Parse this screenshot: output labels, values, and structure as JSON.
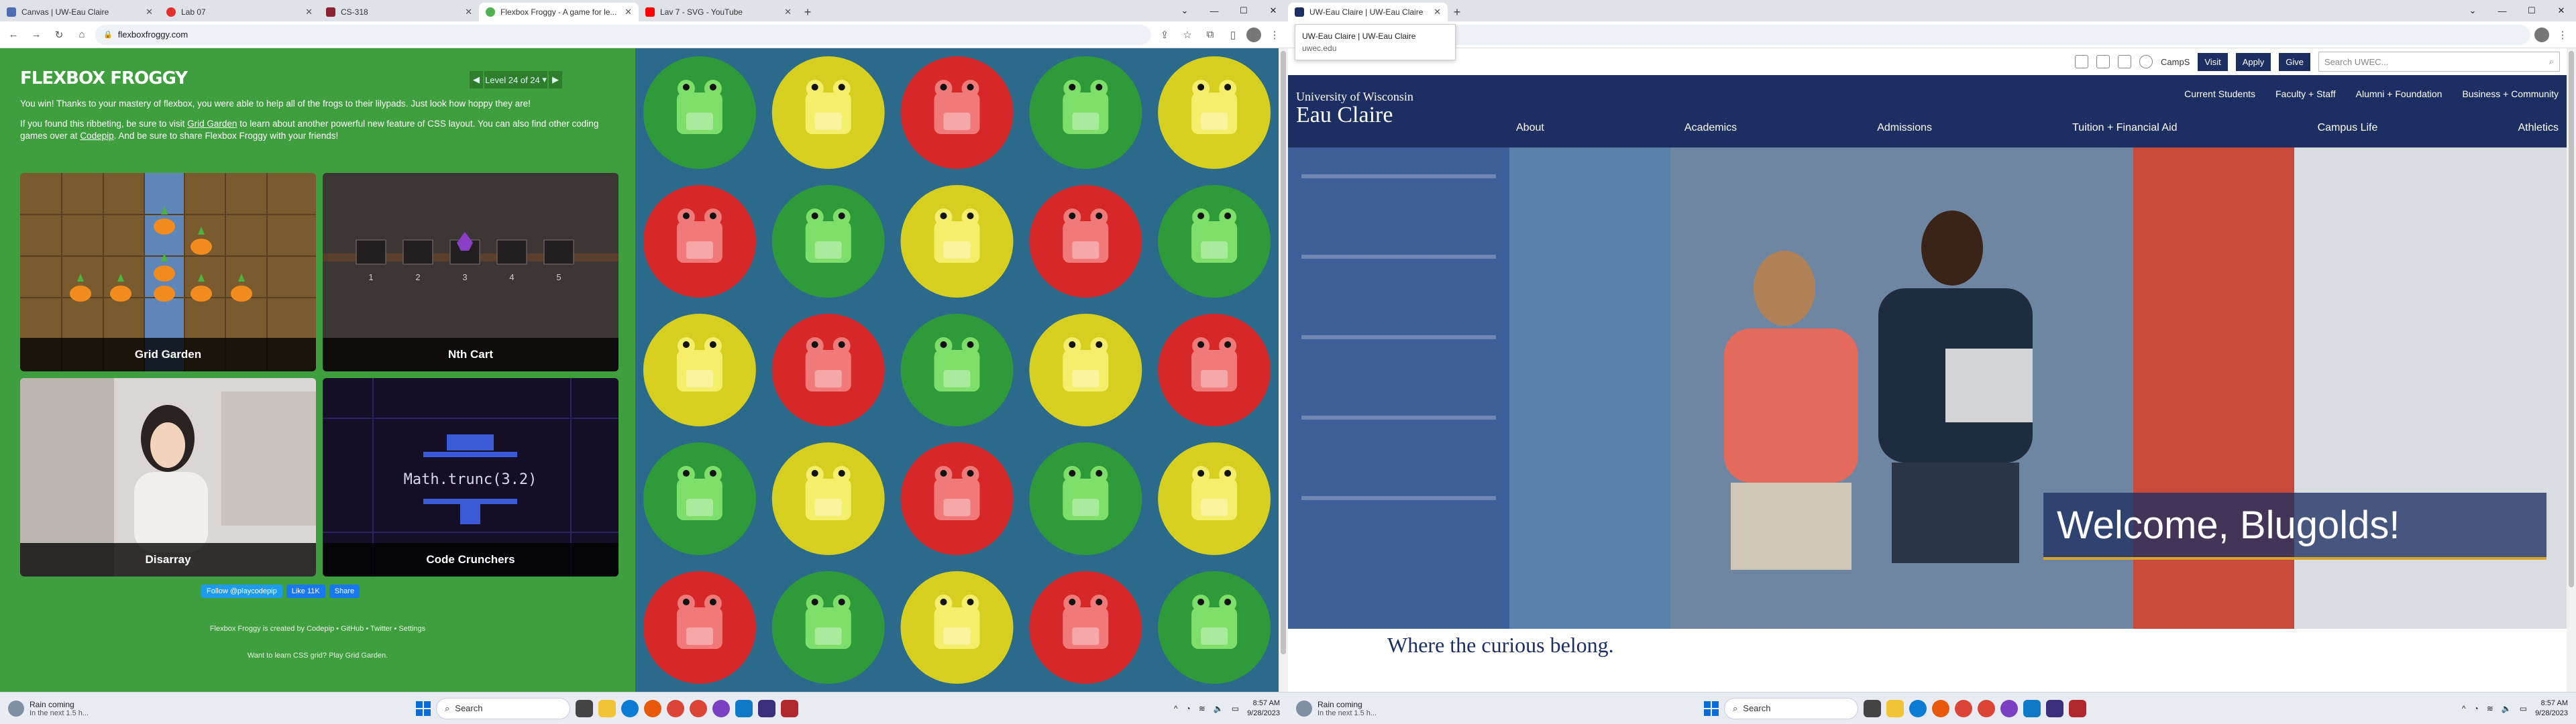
{
  "left": {
    "tabs": [
      {
        "title": "Canvas | UW-Eau Claire",
        "color": "#4f6db4"
      },
      {
        "title": "Lab 07",
        "color": "#e2312d"
      },
      {
        "title": "CS-318",
        "color": "#8b2332"
      },
      {
        "title": "Flexbox Froggy - A game for le...",
        "color": "#4fb24f"
      },
      {
        "title": "Lav 7 - SVG - YouTube",
        "color": "#ff0000"
      }
    ],
    "url": "flexboxfroggy.com",
    "page": {
      "title": "FLEXBOX FROGGY",
      "level": "Level 24 of 24",
      "p1": "You win! Thanks to your mastery of flexbox, you were able to help all of the frogs to their lilypads. Just look how hoppy they are!",
      "p2_a": "If you found this ribbeting, be sure to visit",
      "p2_link": "Grid Garden",
      "p2_b": "to learn about another powerful new feature of CSS layout. You can also find other coding games over at",
      "p2_link2": "Codepip",
      "p2_c": ". And be sure to share Flexbox Froggy with your friends!",
      "games": [
        "Grid Garden",
        "Nth Cart",
        "Disarray",
        "Code Crunchers"
      ],
      "cart_numbers": [
        "1",
        "2",
        "3",
        "4",
        "5"
      ],
      "code_text": "Math.trunc(3.2)",
      "follow": "Follow @playcodepip",
      "like": "Like 11K",
      "share": "Share",
      "credit": "Flexbox Froggy is created by Codepip • GitHub • Twitter • Settings",
      "learn": "Want to learn CSS grid? Play Grid Garden."
    },
    "frog_colors": [
      [
        "green",
        "yellow",
        "red",
        "green",
        "yellow"
      ],
      [
        "red",
        "green",
        "yellow",
        "red",
        "green"
      ],
      [
        "yellow",
        "red",
        "green",
        "yellow",
        "red"
      ],
      [
        "green",
        "yellow",
        "red",
        "green",
        "yellow"
      ],
      [
        "red",
        "green",
        "yellow",
        "red",
        "green"
      ]
    ]
  },
  "right": {
    "tabs": [
      {
        "title": "UW-Eau Claire | UW-Eau Claire",
        "color": "#1d2f62"
      }
    ],
    "tooltip_title": "UW-Eau Claire | UW-Eau Claire",
    "tooltip_url": "uwec.edu",
    "top": {
      "camps": "CampS",
      "visit": "Visit",
      "apply": "Apply",
      "give": "Give",
      "search_placeholder": "Search UWEC..."
    },
    "logo_a": "University of Wisconsin",
    "logo_b": "Eau Claire",
    "audience": [
      "Current Students",
      "Faculty + Staff",
      "Alumni + Foundation",
      "Business + Community"
    ],
    "nav": [
      "About",
      "Academics",
      "Admissions",
      "Tuition + Financial Aid",
      "Campus Life",
      "Athletics"
    ],
    "welcome": "Welcome, Blugolds!",
    "tagline": "Where the curious belong."
  },
  "taskbar": {
    "weather1": "Rain coming",
    "weather2": "In the next 1.5 h...",
    "search": "Search",
    "time": "8:57 AM",
    "date": "9/28/2023"
  }
}
